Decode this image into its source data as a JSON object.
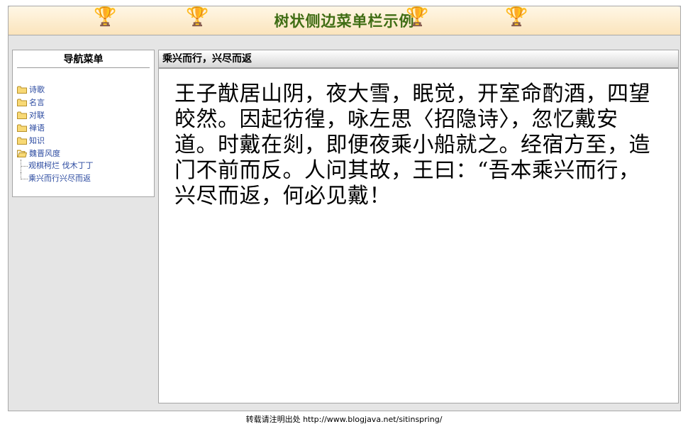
{
  "header": {
    "title": "树状侧边菜单栏示例"
  },
  "sidebar": {
    "title": "导航菜单",
    "items": [
      {
        "label": "诗歌"
      },
      {
        "label": "名言"
      },
      {
        "label": "对联"
      },
      {
        "label": "禅语"
      },
      {
        "label": "知识"
      },
      {
        "label": "魏晋风度"
      }
    ],
    "subitems": [
      {
        "label": "观棋柯烂 伐木丁丁"
      },
      {
        "label": "乘兴而行兴尽而返"
      }
    ]
  },
  "content": {
    "title": "乘兴而行，兴尽而返",
    "body": "王子猷居山阴，夜大雪，眠觉，开室命酌酒，四望皎然。因起彷徨，咏左思〈招隐诗〉，忽忆戴安道。时戴在剡，即便夜乘小船就之。经宿方至，造门不前而反。人问其故，王曰：“吾本乘兴而行，兴尽而返，何必见戴！"
  },
  "footer": {
    "text": "转载请注明出处  http://www.blogjava.net/sitinspring/"
  }
}
